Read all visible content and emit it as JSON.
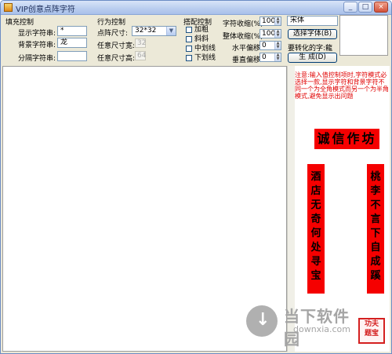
{
  "window": {
    "title": "VIP创意点阵字符",
    "minimize": "_",
    "maximize": "□",
    "close": "×"
  },
  "fill": {
    "group": "填充控制",
    "display_label": "显示字符串:",
    "display_value": "*",
    "background_label": "背景字符串:",
    "background_value": "龙",
    "separator_label": "分隔字符串:",
    "separator_value": ""
  },
  "behavior": {
    "group": "行为控制",
    "size_label": "点阵尺寸:",
    "size_value": "32*32",
    "width_label": "任意尺寸宽:",
    "width_value": "32",
    "height_label": "任意尺寸高:",
    "height_value": "64"
  },
  "style": {
    "group": "搭配控制",
    "bold": "加粗",
    "italic": "斜斜",
    "strike": "中划线",
    "underline": "下划线"
  },
  "tuning": {
    "char_shrink_label": "字符收缩(%)",
    "char_shrink_value": "100",
    "total_shrink_label": "整体收缩(%)",
    "total_shrink_value": "100",
    "h_offset_label": "水平偏移:",
    "h_offset_value": "0",
    "v_offset_label": "垂直偏移:",
    "v_offset_value": "0"
  },
  "font": {
    "name": "宋体",
    "choose_button": "选择字体(B)",
    "convert_label": "要转化的字:",
    "convert_value": "龍",
    "generate_button": "生 成(D)"
  },
  "notice": "注意:输入值控制项时,字符模式必选择一款,显示字符和背景字符不同一个为全角模式而另一个为半角模式,避免显示出问题",
  "couplet": {
    "horizontal": "诚信作坊",
    "right_line": "桃李不言下自成蹊",
    "left_line": "酒店无奇何处寻宝"
  },
  "stamp": "功夫\n题宝",
  "watermark": {
    "cn": "当下软件园",
    "en": "downxia.com"
  }
}
